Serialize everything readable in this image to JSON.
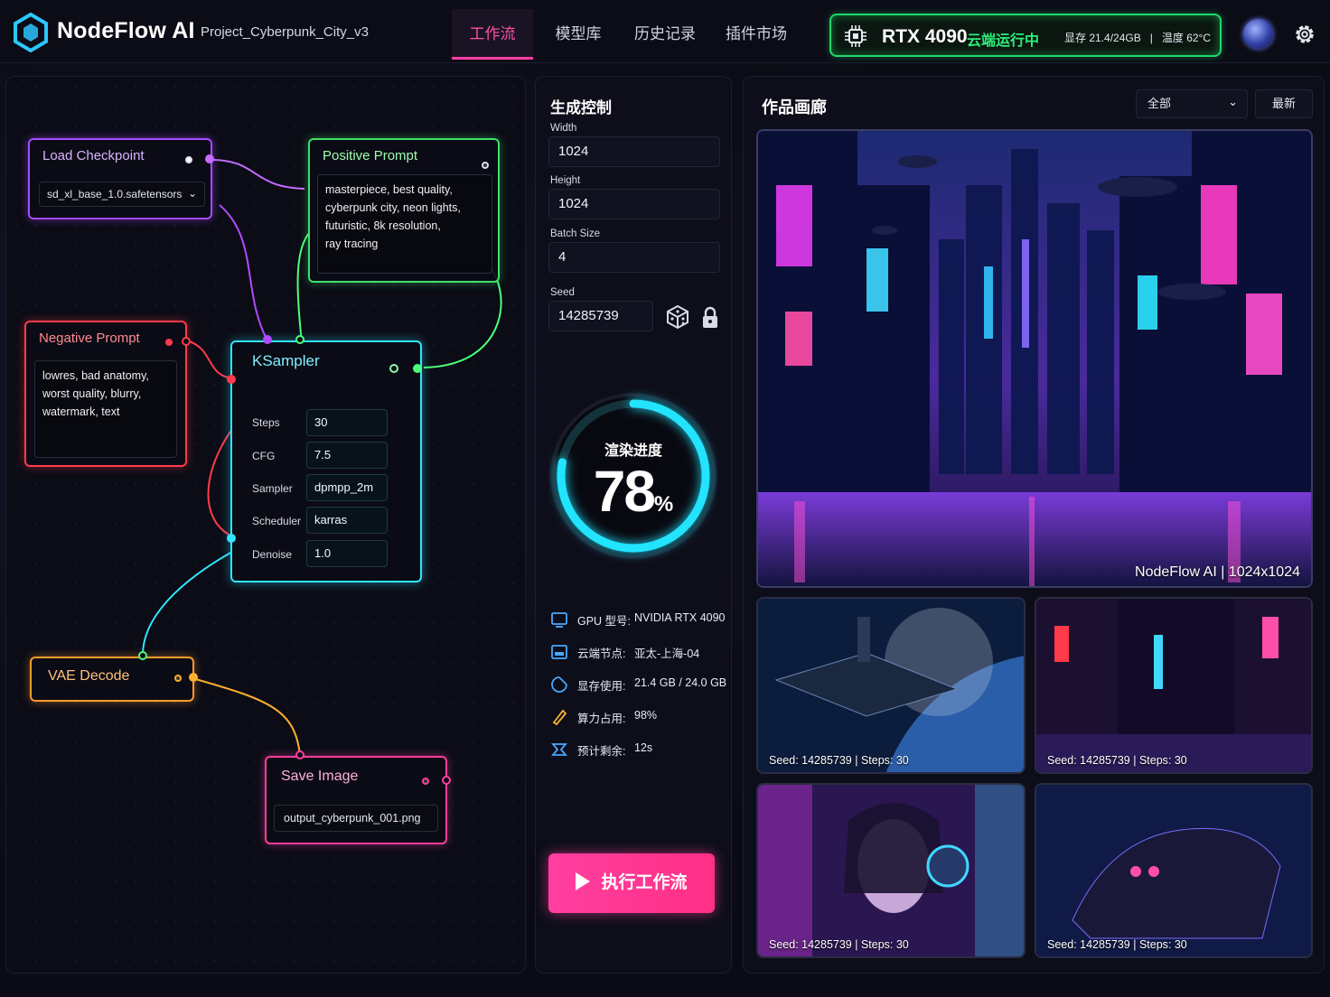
{
  "header": {
    "brand": "NodeFlow AI",
    "project": "Project_Cyberpunk_City_v3",
    "tabs": [
      {
        "label": "工作流",
        "active": true
      },
      {
        "label": "模型库"
      },
      {
        "label": "历史记录"
      },
      {
        "label": "插件市场"
      }
    ],
    "gpu": {
      "name": "RTX 4090",
      "status": "云端运行中",
      "vram": "显存 21.4/24GB",
      "sep": "|",
      "temp": "温度 62°C",
      "color": "#1fd86a"
    },
    "icons": [
      "logo-icon",
      "chip-icon",
      "avatar",
      "gear-icon"
    ]
  },
  "graph": {
    "load_checkpoint": {
      "title": "Load Checkpoint",
      "model": "sd_xl_base_1.0.safetensors"
    },
    "positive_prompt": {
      "title": "Positive Prompt",
      "text": [
        "masterpiece, best quality,",
        "cyberpunk city, neon lights,",
        "futuristic, 8k resolution,",
        "ray tracing"
      ]
    },
    "negative_prompt": {
      "title": "Negative Prompt",
      "text": [
        "lowres, bad anatomy,",
        "worst quality, blurry,",
        "watermark, text"
      ]
    },
    "ksampler": {
      "title": "KSampler",
      "rows": [
        {
          "label": "Steps",
          "value": "30"
        },
        {
          "label": "CFG",
          "value": "7.5"
        },
        {
          "label": "Sampler",
          "value": "dpmpp_2m"
        },
        {
          "label": "Scheduler",
          "value": "karras"
        },
        {
          "label": "Denoise",
          "value": "1.0"
        }
      ]
    },
    "vae_decode": {
      "title": "VAE Decode"
    },
    "save_image": {
      "title": "Save Image",
      "filename": "output_cyberpunk_001.png"
    }
  },
  "control": {
    "title": "生成控制",
    "width_label": "Width",
    "width": "1024",
    "height_label": "Height",
    "height": "1024",
    "batch_label": "Batch Size",
    "batch": "4",
    "seed_label": "Seed",
    "seed": "14285739",
    "progress_label": "渲染进度",
    "progress": 78,
    "progress_value": "78",
    "progress_unit": "%",
    "stats": [
      {
        "icon": "monitor-icon",
        "key": "GPU 型号:",
        "value": "NVIDIA RTX 4090"
      },
      {
        "icon": "server-icon",
        "key": "云端节点:",
        "value": "亚太-上海-04"
      },
      {
        "icon": "memory-icon",
        "key": "显存使用:",
        "value": "21.4 GB / 24.0 GB"
      },
      {
        "icon": "bolt-icon",
        "key": "算力占用:",
        "value": "98%"
      },
      {
        "icon": "hourglass-icon",
        "key": "预计剩余:",
        "value": "12s"
      }
    ],
    "run_label": "执行工作流"
  },
  "gallery": {
    "title": "作品画廊",
    "filter": "全部",
    "sort": "最新",
    "main_caption": "NodeFlow AI | 1024x1024",
    "thumbs": [
      {
        "caption": "Seed: 14285739  |  Steps: 30",
        "subject": "spaceship over planet"
      },
      {
        "caption": "Seed: 14285739  |  Steps: 30",
        "subject": "neon night street"
      },
      {
        "caption": "Seed: 14285739  |  Steps: 30",
        "subject": "cyberpunk girl portrait"
      },
      {
        "caption": "Seed: 14285739  |  Steps: 30",
        "subject": "mech creature"
      }
    ]
  }
}
